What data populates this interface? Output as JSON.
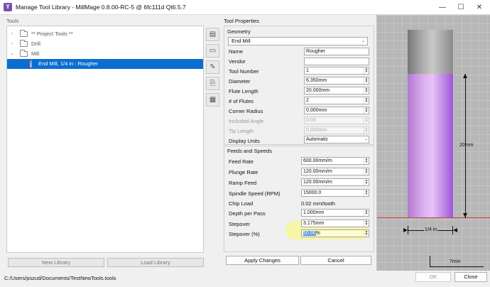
{
  "window": {
    "title": "Manage Tool Library - MillMage 0.8.00-RC-5 @ 6fc111d Qt6.5.7",
    "app_icon": "Y",
    "controls": {
      "minimize": "—",
      "maximize": "☐",
      "close": "✕"
    }
  },
  "left": {
    "tools_label": "Tools",
    "tree": [
      {
        "label": "** Project Tools **",
        "expander": "›",
        "icon": "folder-icon"
      },
      {
        "label": "Drill",
        "expander": "›",
        "icon": "folder-icon"
      },
      {
        "label": "Mill",
        "expander": "⌄",
        "icon": "folder-icon"
      },
      {
        "label": "End Mill, 1/4 in : Rougher",
        "icon": "end-mill-icon",
        "selected": true
      }
    ],
    "new_library": "New Library",
    "load_library": "Load Library"
  },
  "toolstrip": [
    "add-tool-icon",
    "add-folder-icon",
    "edit-icon",
    "copy-icon",
    "paste-icon"
  ],
  "properties": {
    "title": "Tool Properties",
    "geometry_title": "Geometry",
    "tool_type": "End Mill",
    "fields": {
      "name": {
        "label": "Name",
        "value": "Rougher"
      },
      "vendor": {
        "label": "Vendor",
        "value": ""
      },
      "tool_number": {
        "label": "Tool Number",
        "value": "1"
      },
      "diameter": {
        "label": "Diameter",
        "value": "6.350mm"
      },
      "flute_length": {
        "label": "Flute Length",
        "value": "20.000mm"
      },
      "num_flutes": {
        "label": "# of Flutes",
        "value": "2"
      },
      "corner_radius": {
        "label": "Corner Radius",
        "value": "0.000mm"
      },
      "included_angle": {
        "label": "Included Angle",
        "value": "0.00"
      },
      "tip_length": {
        "label": "Tip Length",
        "value": "0.000mm"
      },
      "display_units": {
        "label": "Display Units",
        "value": "Automatic"
      }
    },
    "feeds_title": "Feeds and Speeds",
    "feeds": {
      "feed_rate": {
        "label": "Feed Rate",
        "value": "600.00mm/m"
      },
      "plunge_rate": {
        "label": "Plunge Rate",
        "value": "120.00mm/m"
      },
      "ramp_feed": {
        "label": "Ramp Feed",
        "value": "120.00mm/m"
      },
      "spindle_speed": {
        "label": "Spindle Speed (RPM)",
        "value": "15000.0"
      },
      "chip_load": {
        "label": "Chip Load",
        "value": "0.02 mm/tooth"
      },
      "depth_per_pass": {
        "label": "Depth per Pass",
        "value": "1.000mm"
      },
      "stepover": {
        "label": "Stepover",
        "value": "3.175mm"
      },
      "stepover_pct": {
        "label": "Stepover (%)",
        "value_selected": "50.00",
        "value_rest": "%"
      }
    },
    "apply_changes": "Apply Changes",
    "cancel": "Cancel"
  },
  "preview": {
    "flute_length_dim": "20mm",
    "diameter_dim": "1/4 in",
    "scale_dim": "7mm",
    "colors": {
      "shank": "#a9a9a9",
      "flutes": "#d7a6ef",
      "cut_line": "#d23c3c"
    }
  },
  "footer": {
    "path": "C:/Users/pszud/Documents/TestNewTools.tools",
    "ok": "OK",
    "close": "Close"
  }
}
